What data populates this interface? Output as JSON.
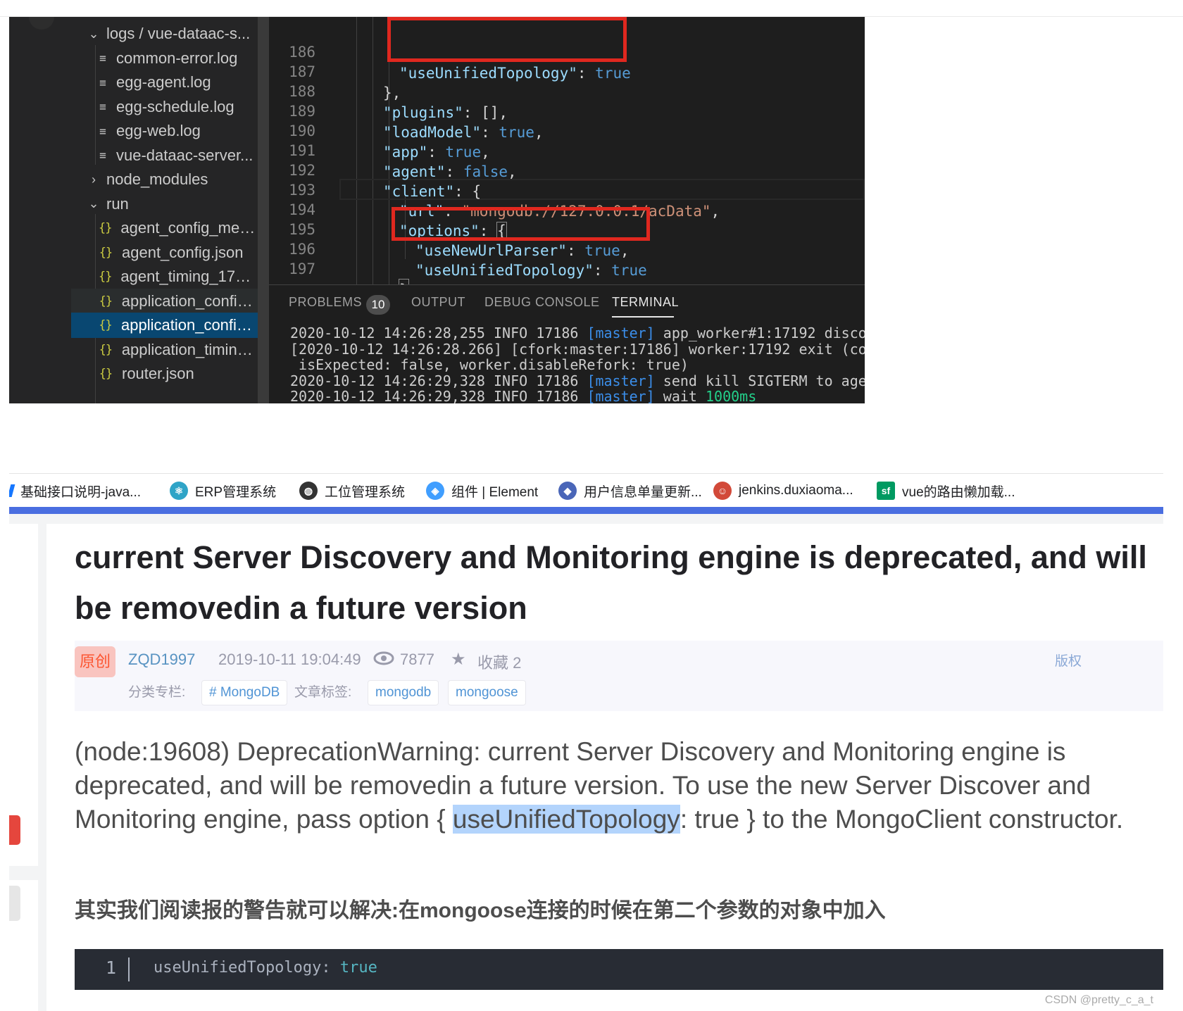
{
  "editor": {
    "explorer": {
      "items": [
        {
          "label": "logs / vue-dataac-s...",
          "kind": "folder-open"
        },
        {
          "label": "common-error.log",
          "kind": "log"
        },
        {
          "label": "egg-agent.log",
          "kind": "log"
        },
        {
          "label": "egg-schedule.log",
          "kind": "log"
        },
        {
          "label": "egg-web.log",
          "kind": "log"
        },
        {
          "label": "vue-dataac-server...",
          "kind": "log"
        },
        {
          "label": "node_modules",
          "kind": "folder-closed"
        },
        {
          "label": "run",
          "kind": "folder-open"
        },
        {
          "label": "agent_config_meta...",
          "kind": "json"
        },
        {
          "label": "agent_config.json",
          "kind": "json"
        },
        {
          "label": "agent_timing_1727...",
          "kind": "json"
        },
        {
          "label": "application_config...",
          "kind": "json"
        },
        {
          "label": "application_config....",
          "kind": "json",
          "selected": true
        },
        {
          "label": "application_timing...",
          "kind": "json"
        },
        {
          "label": "router.json",
          "kind": "json"
        }
      ]
    },
    "code": {
      "line_numbers": [
        "186",
        "187",
        "188",
        "189",
        "190",
        "191",
        "192",
        "193",
        "194",
        "195",
        "196",
        "197"
      ],
      "l186_key": "\"useUnifiedTopology\"",
      "l186_val": "true",
      "l187_text": "},",
      "l188_key": "\"plugins\"",
      "l188_val": "[],",
      "l189_key": "\"loadModel\"",
      "l189_val": "true",
      "l190_key": "\"app\"",
      "l190_val": "true",
      "l191_key": "\"agent\"",
      "l191_val": "false",
      "l192_key": "\"client\"",
      "l192_val": "{",
      "l193_key": "\"url\"",
      "l193_val": "\"mongodb://127.0.0.1/acData\"",
      "l194_key": "\"options\"",
      "l194_val": "{",
      "l195_key": "\"useNewUrlParser\"",
      "l195_val": "true",
      "l196_key": "\"useUnifiedTopology\"",
      "l196_val": "true",
      "l197_text": "}"
    },
    "panel": {
      "tabs": {
        "problems": "PROBLEMS",
        "problems_count": "10",
        "output": "OUTPUT",
        "debug": "DEBUG CONSOLE",
        "terminal": "TERMINAL"
      },
      "terminal_lines": [
        {
          "pre": "2020-10-12 14:26:28,255 INFO 17186 ",
          "tag": "[master]",
          "post": " app_worker#1:17192 disco"
        },
        {
          "pre": "[2020-10-12 14:26:28.266] [cfork:master:17186] worker:17192 exit (co",
          "tag": "",
          "post": ""
        },
        {
          "pre": " isExpected: false, worker.disableRefork: true)",
          "tag": "",
          "post": ""
        },
        {
          "pre": "2020-10-12 14:26:29,328 INFO 17186 ",
          "tag": "[master]",
          "post": " send kill SIGTERM to age"
        },
        {
          "pre": "2020-10-12 14:26:29,328 INFO 17186 ",
          "tag": "[master]",
          "post": " wait ",
          "green": "1000ms"
        }
      ]
    }
  },
  "browser": {
    "bookmarks": [
      {
        "label": "基础接口说明-java...",
        "icon": "doc-icon",
        "color": "#1677ff"
      },
      {
        "label": "ERP管理系统",
        "icon": "react-icon",
        "color": "#2fa4c7"
      },
      {
        "label": "工位管理系统",
        "icon": "globe-icon",
        "color": "#333333"
      },
      {
        "label": "组件 | Element",
        "icon": "element-icon",
        "color": "#409eff"
      },
      {
        "label": "用户信息单量更新...",
        "icon": "shield-icon",
        "color": "#4a66b8"
      },
      {
        "label": "jenkins.duxiaoma...",
        "icon": "jenkins-icon",
        "color": "#d24939"
      },
      {
        "label": "vue的路由懒加载...",
        "icon": "sf-icon",
        "color": "#009a61"
      }
    ],
    "article": {
      "title": "current Server Discovery and Monitoring engine is deprecated, and will be removedin a future version",
      "meta": {
        "badge": "原创",
        "author": "ZQD1997",
        "date": "2019-10-11 19:04:49",
        "views": "7877",
        "favorites": "收藏 2",
        "copyright": "版权",
        "category_label": "分类专栏:",
        "category": "# MongoDB",
        "tags_label": "文章标签:",
        "tags": [
          "mongodb",
          "mongoose"
        ]
      },
      "body_pre": "(node:19608) DeprecationWarning: current Server Discovery and Monitoring engine is deprecated, and will be removedin a future version. To use the new Server Discover and Monitoring engine, pass option { ",
      "body_hl": "useUnifiedTopology",
      "body_post": ": true } to the MongoClient constructor.",
      "body2": "其实我们阅读报的警告就可以解决:在mongoose连接的时候在第二个参数的对象中加入",
      "code_line_no": "1",
      "code_key": "useUnifiedTopology:",
      "code_val": "true"
    },
    "watermark": "CSDN @pretty_c_a_t"
  }
}
